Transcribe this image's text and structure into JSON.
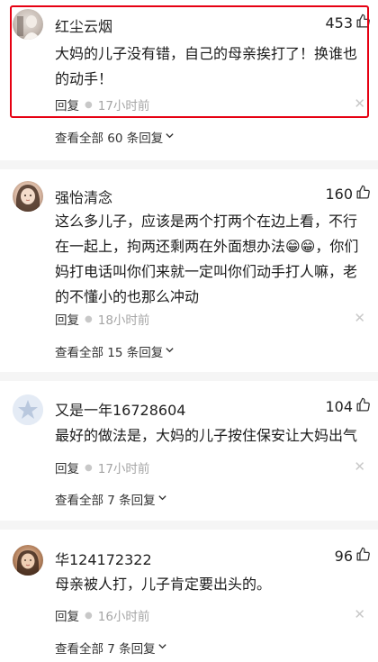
{
  "comments": [
    {
      "username": "红尘云烟",
      "likes": "453",
      "text": "大妈的儿子没有错，自己的母亲挨打了！换谁也的动手！",
      "reply_label": "回复",
      "time": "17小时前",
      "view_all": "查看全部 60 条回复"
    },
    {
      "username": "强怡清念",
      "likes": "160",
      "text": "这么多儿子，应该是两个打两个在边上看，不行在一起上，拘两还剩两在外面想办法😁😁，你们妈打电话叫你们来就一定叫你们动手打人嘛，老的不懂小的也那么冲动",
      "reply_label": "回复",
      "time": "18小时前",
      "view_all": "查看全部 15 条回复"
    },
    {
      "username": "又是一年16728604",
      "likes": "104",
      "text": "最好的做法是，大妈的儿子按住保安让大妈出气",
      "reply_label": "回复",
      "time": "17小时前",
      "view_all": "查看全部 7 条回复"
    },
    {
      "username": "华124172322",
      "likes": "96",
      "text": "母亲被人打，儿子肯定要出头的。",
      "reply_label": "回复",
      "time": "16小时前",
      "view_all": "查看全部 7 条回复"
    }
  ],
  "colors": {
    "highlight": "#e60012",
    "time": "#a5a5a5",
    "separator": "#f5f5f5"
  },
  "icons": {
    "like": "thumbs-up-icon",
    "close": "close-icon",
    "expand": "chevron-down-icon"
  }
}
